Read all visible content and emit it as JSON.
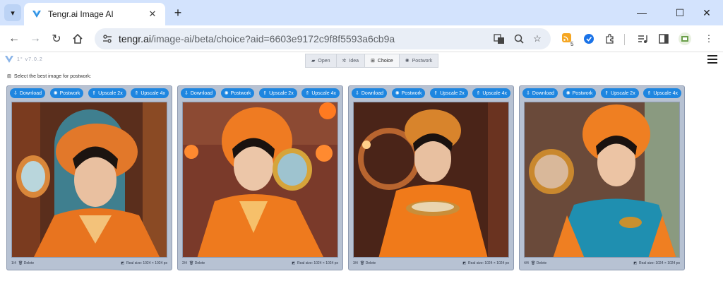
{
  "browser": {
    "tab_title": "Tengr.ai Image AI",
    "url_host": "tengr.ai",
    "url_path": "/image-ai/beta/choice?aid=6603e9172c9f8f5593a6cb9a",
    "extension_badge": "5",
    "accent": "#d3e3fd"
  },
  "app": {
    "version": "1° v7.0.2",
    "steps": [
      {
        "label": "Open"
      },
      {
        "label": "Idea"
      },
      {
        "label": "Choice"
      },
      {
        "label": "Postwork"
      }
    ],
    "instruction": "Select the best image for postwork:",
    "buttons": {
      "download": "Download",
      "postwork": "Postwork",
      "upscale2x": "Upscale 2x",
      "upscale4x": "Upscale 4x"
    },
    "delete_label": "Delete",
    "real_size": "Real size: 1024 × 1024 px",
    "cards": [
      {
        "index": "1/4"
      },
      {
        "index": "2/4"
      },
      {
        "index": "3/4"
      },
      {
        "index": "4/4"
      }
    ]
  }
}
